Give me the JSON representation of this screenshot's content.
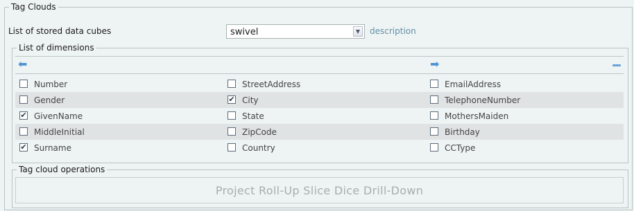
{
  "outer_title": "Tag Clouds",
  "cubes": {
    "label": "List of stored data cubes",
    "selected": "swivel",
    "description_link": "description"
  },
  "dimensions": {
    "title": "List of dimensions",
    "rows": [
      [
        {
          "label": "Number",
          "checked": false
        },
        {
          "label": "StreetAddress",
          "checked": false
        },
        {
          "label": "EmailAddress",
          "checked": false
        }
      ],
      [
        {
          "label": "Gender",
          "checked": false
        },
        {
          "label": "City",
          "checked": true
        },
        {
          "label": "TelephoneNumber",
          "checked": false
        }
      ],
      [
        {
          "label": "GivenName",
          "checked": true
        },
        {
          "label": "State",
          "checked": false
        },
        {
          "label": "MothersMaiden",
          "checked": false
        }
      ],
      [
        {
          "label": "MiddleInitial",
          "checked": false
        },
        {
          "label": "ZipCode",
          "checked": false
        },
        {
          "label": "Birthday",
          "checked": false
        }
      ],
      [
        {
          "label": "Surname",
          "checked": true
        },
        {
          "label": "Country",
          "checked": false
        },
        {
          "label": "CCType",
          "checked": false
        }
      ]
    ]
  },
  "operations": {
    "title": "Tag cloud operations",
    "text": "Project Roll-Up Slice Dice Drill-Down"
  },
  "icons": {
    "left": "arrow-left-icon",
    "right": "arrow-right-icon",
    "collapse": "minus-icon",
    "check": "✔"
  }
}
